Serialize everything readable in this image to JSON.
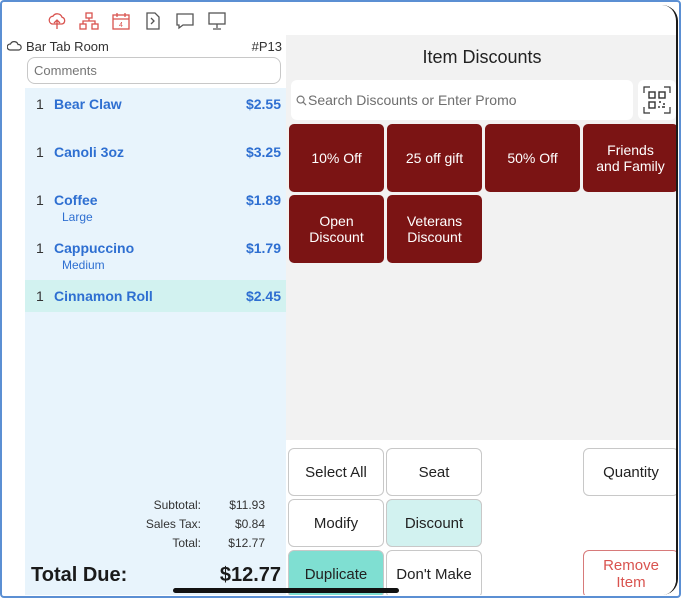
{
  "toolbar": {
    "icons": [
      "cloud-upload-icon",
      "network-icon",
      "calendar-icon",
      "document-icon",
      "chat-icon",
      "kiosk-icon"
    ]
  },
  "ticket": {
    "room": "Bar Tab Room",
    "number": "#P13",
    "comments_placeholder": "Comments",
    "items": [
      {
        "qty": "1",
        "name": "Bear Claw",
        "price": "$2.55",
        "modifier": ""
      },
      {
        "qty": "1",
        "name": "Canoli 3oz",
        "price": "$3.25",
        "modifier": ""
      },
      {
        "qty": "1",
        "name": "Coffee",
        "price": "$1.89",
        "modifier": "Large"
      },
      {
        "qty": "1",
        "name": "Cappuccino",
        "price": "$1.79",
        "modifier": "Medium"
      },
      {
        "qty": "1",
        "name": "Cinnamon Roll",
        "price": "$2.45",
        "modifier": ""
      }
    ],
    "totals": {
      "subtotal_label": "Subtotal:",
      "subtotal": "$11.93",
      "tax_label": "Sales Tax:",
      "tax": "$0.84",
      "total_label": "Total:",
      "total": "$12.77"
    },
    "due_label": "Total Due:",
    "due_value": "$12.77"
  },
  "panel": {
    "title": "Item Discounts",
    "search_placeholder": "Search Discounts or Enter Promo",
    "discounts": [
      "10% Off",
      "25 off gift",
      "50% Off",
      "Friends\nand Family",
      "Open\nDiscount",
      "Veterans\nDiscount"
    ],
    "actions": {
      "select_all": "Select All",
      "seat": "Seat",
      "quantity": "Quantity",
      "modify": "Modify",
      "discount": "Discount",
      "duplicate": "Duplicate",
      "dont_make": "Don't Make",
      "remove_item": "Remove\nItem"
    }
  },
  "colors": {
    "accent_blue": "#2e6fd1",
    "discount_red": "#7b1414",
    "teal": "#7fdfd2",
    "teal_light": "#d2f2f0",
    "remove_red": "#d9534f"
  }
}
